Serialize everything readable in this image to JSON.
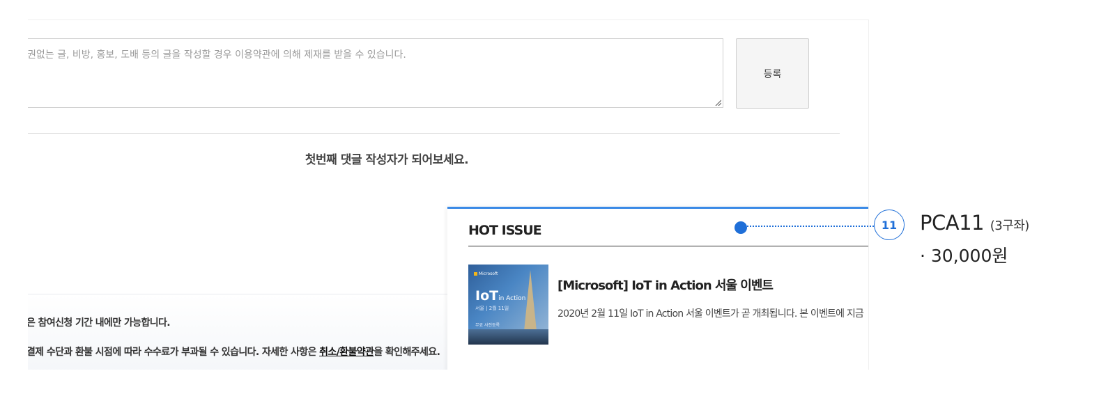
{
  "comment": {
    "placeholder": "권없는 글, 비방, 홍보, 도배 등의 글을 작성할 경우 이용약관에 의해 제재를 받을 수 있습니다.",
    "submit_label": "등록",
    "empty_message": "첫번째 댓글 작성자가 되어보세요."
  },
  "notices": {
    "line1": "은 참여신청 기간 내에만 가능합니다.",
    "line2_before": "결제 수단과 환불 시점에 따라 수수료가 부과될 수 있습니다. 자세한 사항은 ",
    "line2_link": "취소/환불약관",
    "line2_after": "을 확인해주세요."
  },
  "hot_issue": {
    "title": "HOT ISSUE",
    "accent_color": "#3b8ae6",
    "item": {
      "headline": "[Microsoft] IoT in Action 서울 이벤트",
      "description": "2020년 2월 11일 IoT in Action 서울 이벤트가 곧 개최됩니다. 본 이벤트에 지금",
      "thumbnail": {
        "logo_text": "Microsoft",
        "title_main": "IoT",
        "title_sub": "in Action",
        "date_text": "서울 | 2월 11일",
        "small_text": "무료 사전등록"
      }
    }
  },
  "annotation": {
    "number": "11",
    "plan_name": "PCA11",
    "plan_sub": "(3구좌)",
    "price": "· 30,000원",
    "color": "#1f6fd8"
  }
}
